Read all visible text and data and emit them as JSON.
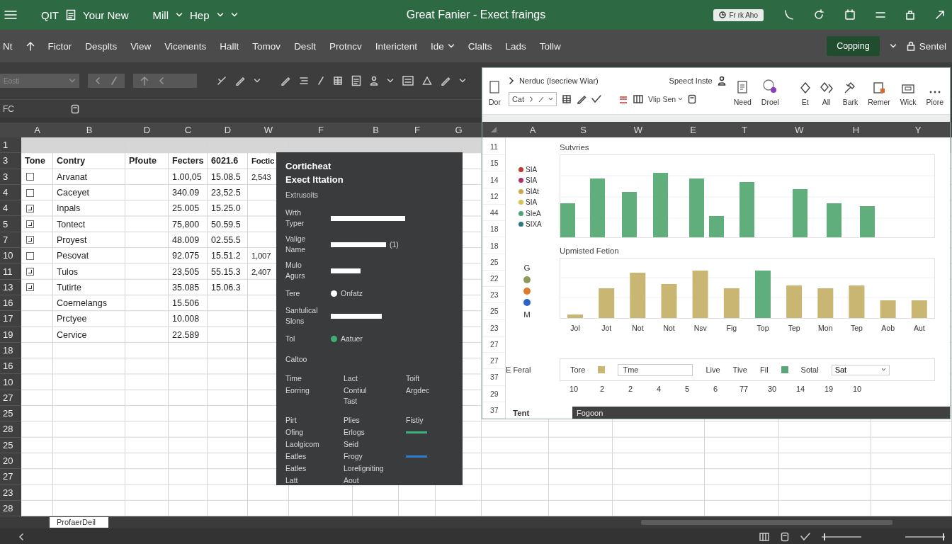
{
  "title_bar": {
    "app_name": "QIT",
    "doc_tab": "Your New",
    "menus": [
      {
        "label": "Mill"
      },
      {
        "label": "Hep"
      }
    ],
    "title": "Great Fanier - Exect fraings",
    "action_button": "Fr rk Aho"
  },
  "menu_bar": {
    "lead": "Nt",
    "items": [
      {
        "label": "Fictor",
        "has_caret": false
      },
      {
        "label": "Desplts",
        "has_caret": false
      },
      {
        "label": "View",
        "has_caret": false
      },
      {
        "label": "Vicenents",
        "has_caret": false
      },
      {
        "label": "Hallt",
        "has_caret": false
      },
      {
        "label": "Tomov",
        "has_caret": false
      },
      {
        "label": "Deslt",
        "has_caret": false
      },
      {
        "label": "Protncv",
        "has_caret": false
      },
      {
        "label": "Interictent",
        "has_caret": false
      },
      {
        "label": "Ide",
        "has_caret": true
      },
      {
        "label": "Clalts",
        "has_caret": false
      },
      {
        "label": "Lads",
        "has_caret": false
      },
      {
        "label": "Tollw",
        "has_caret": false
      }
    ],
    "primary_button": "Copping",
    "account": "Sentel"
  },
  "toolbar": {
    "name_box": "Eosti"
  },
  "formula_bar": {
    "cell_ref": "FC"
  },
  "sheet": {
    "columns": [
      "A",
      "B",
      "D",
      "C",
      "D",
      "W",
      "F",
      "B",
      "F",
      "G"
    ],
    "row_numbers": [
      "1",
      "3",
      "3",
      "4",
      "4",
      "5",
      "7",
      "10",
      "11",
      "13",
      "16",
      "17",
      "19",
      "18",
      "16",
      "10",
      "27",
      "25",
      "28",
      "25",
      "20",
      "27",
      "23",
      "28"
    ],
    "header": [
      "Tone",
      "Contry",
      "Pfoute",
      "Fecters",
      "6021.6",
      "Foctic"
    ],
    "rows": [
      {
        "kind": "check",
        "checked": false,
        "name": "Arvanat",
        "values": [
          "1.00,05",
          "15.08.5",
          "2,543"
        ]
      },
      {
        "kind": "check",
        "checked": false,
        "name": "Caceyet",
        "values": [
          "340.09",
          "23,52.5"
        ]
      },
      {
        "kind": "check",
        "checked": true,
        "name": "Inpals",
        "values": [
          "25.005",
          "15.25.0"
        ]
      },
      {
        "kind": "check",
        "checked": true,
        "name": "Tontect",
        "values": [
          "75,800",
          "50.59.5"
        ]
      },
      {
        "kind": "check",
        "checked": true,
        "name": "Proyest",
        "values": [
          "48.009",
          "02.55.5"
        ]
      },
      {
        "kind": "check",
        "checked": false,
        "name": "Pesovat",
        "values": [
          "92.075",
          "15.51.2",
          "1,007"
        ]
      },
      {
        "kind": "check",
        "checked": true,
        "name": "Tulos",
        "values": [
          "23,505",
          "55.15.3",
          "2,407"
        ]
      },
      {
        "kind": "check",
        "checked": true,
        "name": "Tutirte",
        "values": [
          "35.085",
          "15.06.3"
        ]
      },
      {
        "kind": "plain",
        "name": "Coernelangs",
        "values": [
          "15.506"
        ]
      },
      {
        "kind": "plain",
        "name": "Prctyee",
        "values": [
          "10.008"
        ]
      },
      {
        "kind": "plain",
        "name": "Cervice",
        "values": [
          "22.589"
        ]
      }
    ],
    "sheet_tabs": [
      {
        "label": "ProfaerDeil",
        "selected": true
      }
    ]
  },
  "panel": {
    "title": "Corticheat\nExect Ittation",
    "subtitle": "Extrusoits",
    "form": [
      {
        "kind": "field",
        "label": "Wrth\nTyper"
      },
      {
        "kind": "field",
        "label": "Valige\nName",
        "suffix": "(1)"
      },
      {
        "kind": "field",
        "label": "Mulo\nAgurs"
      },
      {
        "kind": "radio",
        "label": "Tere",
        "option": "Onfatz",
        "selected": false
      },
      {
        "kind": "field",
        "label": "Santulical\nSlons"
      },
      {
        "kind": "radio",
        "label": "Tol",
        "option": "Aatuer",
        "selected": true
      }
    ],
    "section": "Caltoo",
    "grid": [
      [
        {
          "kind": "text",
          "text": "Time"
        },
        {
          "kind": "text",
          "text": "Lact"
        },
        {
          "kind": "text",
          "text": "Toift"
        }
      ],
      [
        {
          "kind": "text",
          "text": "Eorring"
        },
        {
          "kind": "text",
          "text": "Contiul\nTast"
        },
        {
          "kind": "text",
          "text": "Argdec"
        }
      ],
      [
        {
          "kind": "text",
          "text": "Pirt"
        },
        {
          "kind": "text",
          "text": "Plies"
        },
        {
          "kind": "text",
          "text": "Fistiy"
        }
      ],
      [
        {
          "kind": "text",
          "text": "Ofing"
        },
        {
          "kind": "text",
          "text": "Erlogs"
        },
        {
          "kind": "line",
          "color": "#3cb37a"
        }
      ],
      [
        {
          "kind": "text",
          "text": "Laolgicom"
        },
        {
          "kind": "text",
          "text": "Seid"
        }
      ],
      [
        {
          "kind": "text",
          "text": "Eatles"
        },
        {
          "kind": "text",
          "text": "Frogy"
        },
        {
          "kind": "line",
          "color": "#2f7fd0"
        }
      ],
      [
        {
          "kind": "text",
          "text": "Eatles"
        },
        {
          "kind": "text",
          "text": "Loreligniting"
        }
      ],
      [
        {
          "kind": "text",
          "text": "Latt"
        },
        {
          "kind": "text",
          "text": "Aout"
        }
      ]
    ]
  },
  "chart_window": {
    "ribbon": {
      "breadcrumb": "Nerduc (Isecriew Wiar)",
      "share_label": "Speect Inste",
      "font_box": "Cat",
      "style_dropdown": "Vlip Sen",
      "buttons": [
        {
          "label": "Dor"
        },
        {
          "label": "Need"
        },
        {
          "label": "Droel"
        },
        {
          "label": "Et"
        },
        {
          "label": "All"
        },
        {
          "label": "Bark"
        },
        {
          "label": "Remer"
        },
        {
          "label": "Wick"
        },
        {
          "label": "Piore"
        }
      ]
    },
    "columns": [
      "A",
      "S",
      "W",
      "E",
      "T",
      "W",
      "H",
      "Y"
    ],
    "row_numbers": [
      "11",
      "15",
      "14",
      "12",
      "44",
      "18",
      "18",
      "25",
      "22",
      "23",
      "25",
      "23",
      "27",
      "27",
      "37",
      "29",
      "37"
    ],
    "chart_1": {
      "title": "Sutvries",
      "legend": [
        {
          "label": "SIA",
          "color": "#c0392b"
        },
        {
          "label": "SIA",
          "color": "#b0306a"
        },
        {
          "label": "SIAt",
          "color": "#c9a94a"
        },
        {
          "label": "SIA",
          "color": "#d9bf55"
        },
        {
          "label": "SIeA",
          "color": "#4fa27c"
        },
        {
          "label": "SIXA",
          "color": "#2a7a86"
        }
      ]
    },
    "chart_2": {
      "title": "Upmisted Fetion",
      "legend_top": "G",
      "legend_dots": [
        {
          "color": "#8f9a5a"
        },
        {
          "color": "#e07b2a"
        },
        {
          "color": "#2a62c9"
        }
      ],
      "legend_bottom": "M",
      "x_labels": [
        "Jol",
        "Jot",
        "Not",
        "Not",
        "Nsv",
        "Fig",
        "Top",
        "Tep",
        "Mon",
        "Tep",
        "Aob",
        "Aut"
      ]
    },
    "totals": {
      "label": "E Feral",
      "items": [
        {
          "kind": "text",
          "text": "Tore"
        },
        {
          "kind": "swatch",
          "color": "#c9b672"
        },
        {
          "kind": "field",
          "text": "Tme"
        },
        {
          "kind": "text",
          "text": "Live"
        },
        {
          "kind": "text",
          "text": "Tive"
        },
        {
          "kind": "text",
          "text": "Fil"
        },
        {
          "kind": "swatch",
          "color": "#5aa878"
        },
        {
          "kind": "text",
          "text": "Sotal"
        },
        {
          "kind": "dropdown",
          "text": "Sat"
        }
      ]
    },
    "number_row": [
      "10",
      "2",
      "2",
      "4",
      "5",
      "6",
      "77",
      "30",
      "14",
      "19",
      "10"
    ],
    "footer": {
      "label": "Tent",
      "bar_text": "Fogoon"
    }
  },
  "status_bar": {
    "sliders": [
      {
        "level": 0.05
      },
      {
        "level": 0.95
      }
    ]
  }
}
